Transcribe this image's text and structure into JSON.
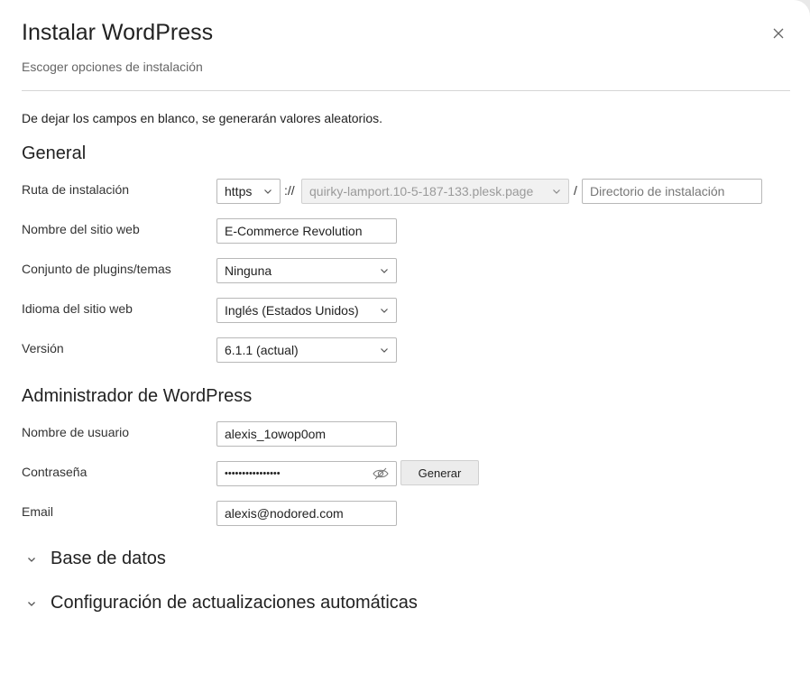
{
  "dialog": {
    "title": "Instalar WordPress",
    "subtitle": "Escoger opciones de instalación",
    "hint": "De dejar los campos en blanco, se generarán valores aleatorios."
  },
  "general": {
    "heading": "General",
    "path": {
      "label": "Ruta de instalación",
      "protocol": "https",
      "separator_slashes": "://",
      "domain": "quirky-lamport.10-5-187-133.plesk.page",
      "separator_slash": "/",
      "directory_placeholder": "Directorio de instalación"
    },
    "site_name": {
      "label": "Nombre del sitio web",
      "value": "E-Commerce Revolution"
    },
    "plugin_set": {
      "label": "Conjunto de plugins/temas",
      "value": "Ninguna"
    },
    "language": {
      "label": "Idioma del sitio web",
      "value": "Inglés (Estados Unidos)"
    },
    "version": {
      "label": "Versión",
      "value": "6.1.1 (actual)"
    }
  },
  "admin": {
    "heading": "Administrador de WordPress",
    "username": {
      "label": "Nombre de usuario",
      "value": "alexis_1owop0om"
    },
    "password": {
      "label": "Contraseña",
      "masked": "••••••••••••••••",
      "generate_label": "Generar"
    },
    "email": {
      "label": "Email",
      "value": "alexis@nodored.com"
    }
  },
  "sections": {
    "database": "Base de datos",
    "auto_updates": "Configuración de actualizaciones automáticas"
  }
}
